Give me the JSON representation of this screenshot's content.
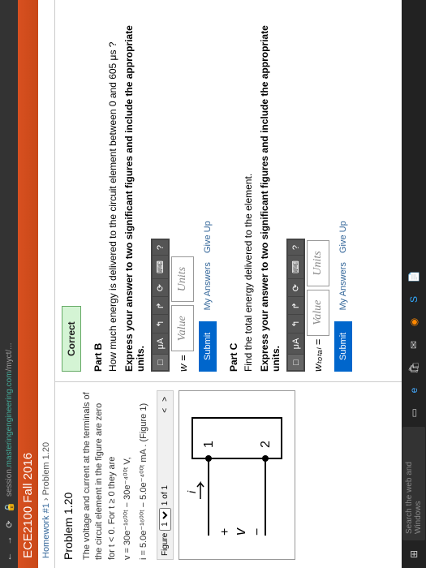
{
  "browser": {
    "url_prefix": "session.",
    "url_highlight": "masteringengineering.com",
    "url_suffix": "/myct/..."
  },
  "header": {
    "title": "ECE2100 Fall 2016"
  },
  "breadcrumb": {
    "hw": "Homework #1",
    "problem": "Problem 1.20"
  },
  "problem": {
    "title": "Problem 1.20",
    "intro": "The voltage and current at the terminals of the circuit element in the figure are zero for t < 0. For t ≥ 0 they are",
    "eq_v": "v = 30e⁻¹⁶⁰⁰ᵗ − 30e⁻⁴⁰⁰ᵗ  V,",
    "eq_i": "i = 5.0e⁻¹⁶⁰⁰ᵗ − 5.0e⁻⁴⁰⁰ᵗ  mA . (Figure 1)",
    "figure_label": "Figure",
    "figure_count": "1 of 1"
  },
  "answer": {
    "correct": "Correct",
    "partB": {
      "label": "Part B",
      "q": "How much energy is delivered to the circuit element between 0 and 605 μs ?",
      "instr": "Express your answer to two significant figures and include the appropriate units.",
      "var": "w =",
      "value_ph": "Value",
      "units_ph": "Units"
    },
    "partC": {
      "label": "Part C",
      "q": "Find the total energy delivered to the element.",
      "instr": "Express your answer to two significant figures and include the appropriate units.",
      "var": "wₜₒₜₐₗ =",
      "value_ph": "Value",
      "units_ph": "Units"
    },
    "toolbar": {
      "b0": "□",
      "b1": "μA",
      "b2": "↰",
      "b3": "↱",
      "b4": "⟳",
      "b5": "⌨",
      "b6": "?"
    },
    "submit": "Submit",
    "my_answers": "My Answers",
    "give_up": "Give Up"
  },
  "taskbar": {
    "search_ph": "Search the web and Windows"
  }
}
